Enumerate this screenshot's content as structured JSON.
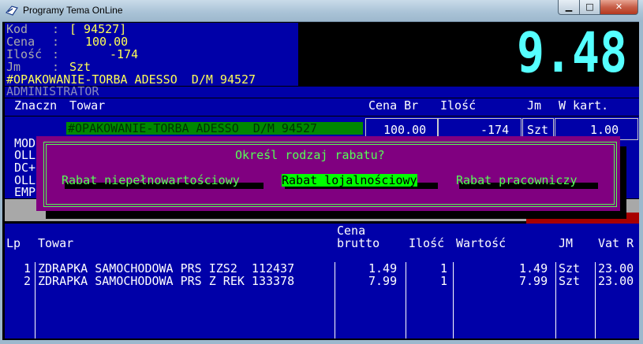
{
  "window": {
    "title": "Programy Tema OnLine",
    "minimize_label": "▁",
    "maximize_label": "□",
    "close_label": "✕"
  },
  "info": {
    "kod_label": "Kod",
    "kod_value": "[ 94527]",
    "cena_label": "Cena",
    "cena_value": "100.00",
    "ilosc_label": "Ilość",
    "ilosc_value": "-174",
    "jm_label": "Jm",
    "jm_value": "Szt",
    "product_line": "#OPAKOWANIE-TORBA ADESSO  D/M 94527"
  },
  "big_total": "9.48",
  "operator": "ADMINISTRATOR",
  "header": {
    "znaczn": "Znaczn",
    "towar": "Towar",
    "cena_br": "Cena Br",
    "ilosc": "Ilość",
    "jm": "Jm",
    "w_kart": "W kart."
  },
  "current_item": {
    "name": "#OPAKOWANIE-TORBA ADESSO  D/M 94527",
    "price": "100.00",
    "qty": "-174",
    "jm": "Szt",
    "w_kart": "1.00"
  },
  "left_codes": [
    "MOD",
    "OLL",
    "DC+",
    "OLL",
    "EMP"
  ],
  "dialog": {
    "title": "Określ rodzaj rabatu?",
    "options": [
      "Rabat niepełnowartościowy",
      "Rabat lojalnościowy",
      "Rabat pracowniczy"
    ],
    "selected_index": 1
  },
  "list": {
    "headers": {
      "lp": "Lp",
      "towar": "Towar",
      "cena_line1": "Cena",
      "cena_line2": "brutto",
      "ilosc": "Ilość",
      "wartosc": "Wartość",
      "jm": "JM",
      "vat": "Vat R"
    },
    "rows": [
      {
        "lp": "1",
        "towar": "ZDRAPKA SAMOCHODOWA PRS IZS2  112437",
        "cena": "1.49",
        "ilosc": "1",
        "wartosc": "1.49",
        "jm": "Szt",
        "vat": "23.00"
      },
      {
        "lp": "2",
        "towar": "ZDRAPKA SAMOCHODOWA PRS Z REK 133378",
        "cena": "7.99",
        "ilosc": "1",
        "wartosc": "7.99",
        "jm": "Szt",
        "vat": "23.00"
      }
    ]
  },
  "colors": {
    "terminal_blue": "#0000a8",
    "dialog_purple": "#800080",
    "highlight_green": "#00ff00",
    "total_cyan": "#55ffff",
    "label_yellow": "#ffff55"
  }
}
